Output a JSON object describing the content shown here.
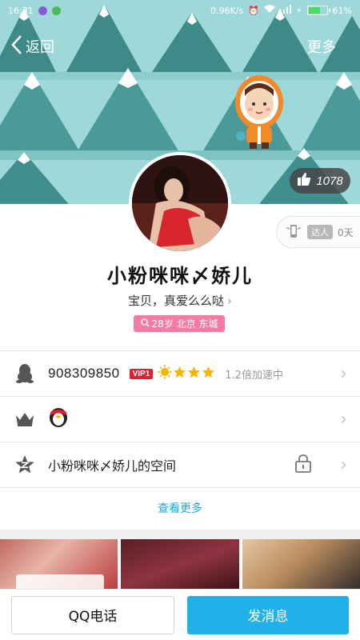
{
  "status_bar": {
    "time": "16:31",
    "net_speed": "0.96K/s",
    "battery": "61%"
  },
  "nav": {
    "back_label": "返回",
    "more_label": "更多"
  },
  "likes": {
    "count": "1078"
  },
  "expert": {
    "tag": "达人",
    "days": "0天"
  },
  "profile": {
    "name": "小粉咪咪〆娇儿",
    "signature": "宝贝，真爱么么哒",
    "info_tag": "28岁 北京 东城"
  },
  "rows": {
    "qq_number": "908309850",
    "vip_label": "VIP1",
    "speed_text": "1.2倍加速中",
    "space_title": "小粉咪咪〆娇儿的空间"
  },
  "see_more": "查看更多",
  "bottom": {
    "call_label": "QQ电话",
    "message_label": "发消息"
  },
  "colors": {
    "accent": "#22b0ea",
    "link": "#22a6e0",
    "tag_pink": "#f57aa5",
    "vip_red": "#d9232e",
    "banner_sky": "#9fd8d8",
    "banner_tree": "#3f8f8e"
  }
}
